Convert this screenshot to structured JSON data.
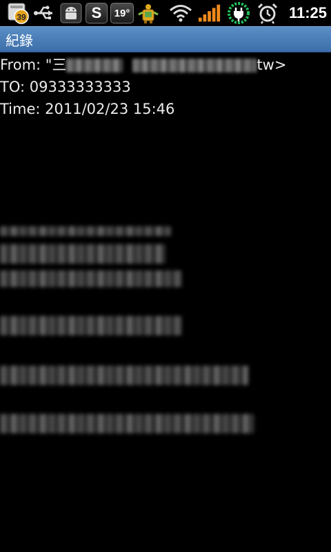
{
  "status_bar": {
    "notification_count": "39",
    "temperature": "19°",
    "skype_letter": "S",
    "clock": "11:25",
    "icons": [
      "message-notification-icon",
      "usb-icon",
      "android-debug-icon",
      "skype-icon",
      "weather-icon",
      "app-robot-icon",
      "wifi-icon",
      "signal-icon",
      "battery-charging-icon",
      "alarm-icon"
    ]
  },
  "title_bar": {
    "title": "紀錄"
  },
  "message": {
    "from_prefix": "From: \"三",
    "from_suffix": "tw>",
    "to": "TO: 09333333333",
    "time": "Time: 2011/02/23 15:46"
  },
  "colors": {
    "title_bar": "#4a80bb",
    "background": "#000000",
    "text": "#ececec"
  }
}
